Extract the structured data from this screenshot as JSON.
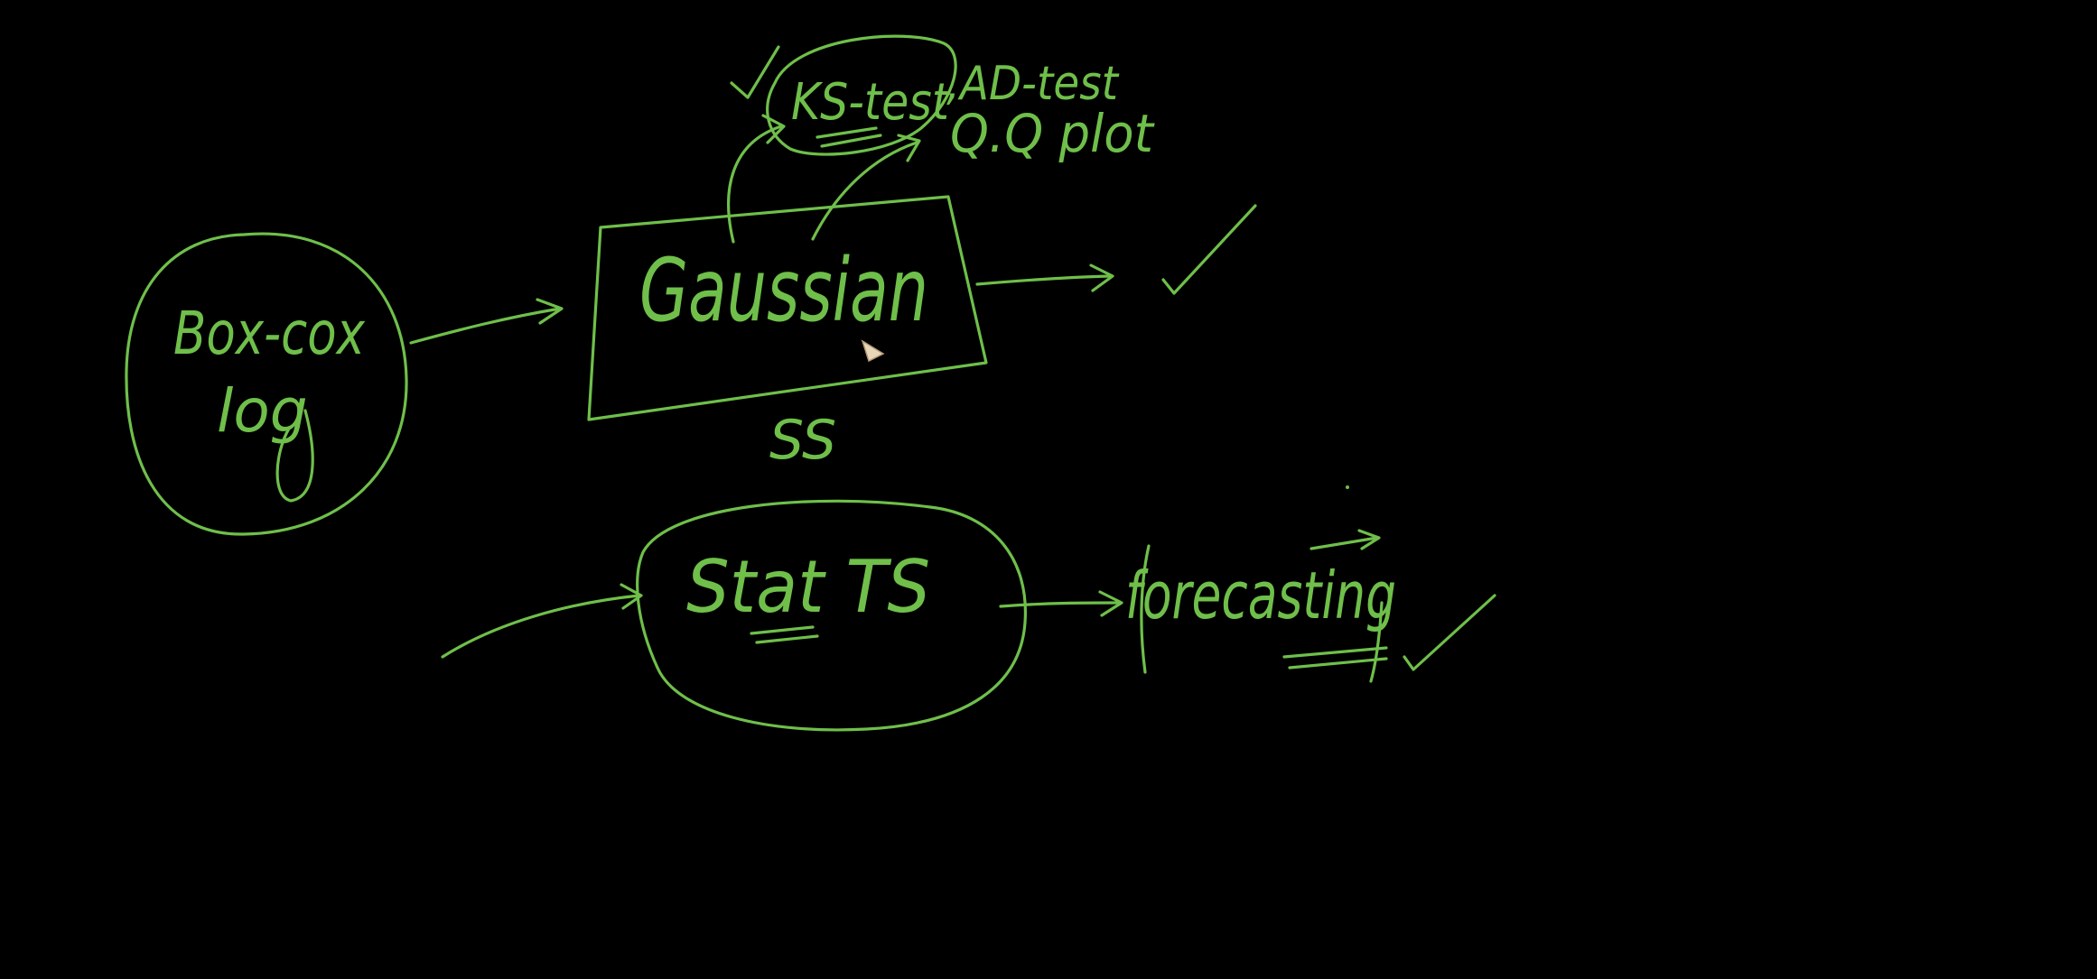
{
  "board": {
    "background": "#000000",
    "ink_color": "#6fbf4a"
  },
  "nodes": {
    "box_cox": {
      "line1": "Box-cox",
      "line2": "log"
    },
    "gaussian": {
      "label": "Gaussian",
      "note": "SS"
    },
    "tests": {
      "ks": "KS-test",
      "ad": ",AD-test",
      "qq": "Q.Q plot"
    },
    "stat_ts": {
      "label": "Stat TS"
    },
    "forecasting": {
      "label": "forecasting"
    }
  },
  "icons": [
    "checkmark-icon",
    "arrow-icon",
    "pen-cursor-icon"
  ]
}
